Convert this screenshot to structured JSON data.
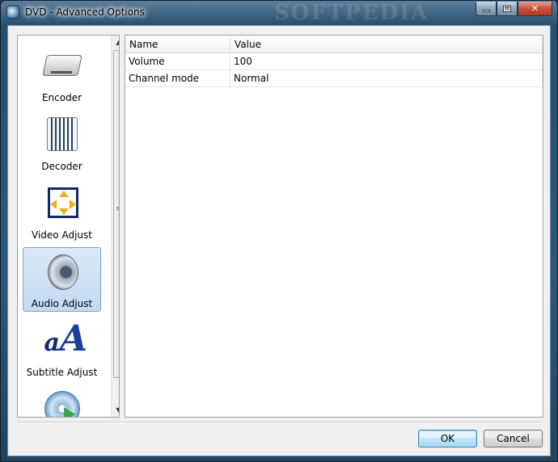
{
  "window": {
    "title": "DVD - Advanced Options",
    "watermark": "SOFTPEDIA"
  },
  "sidebar": {
    "items": [
      {
        "label": "Encoder",
        "icon": "encoder-icon"
      },
      {
        "label": "Decoder",
        "icon": "decoder-icon"
      },
      {
        "label": "Video Adjust",
        "icon": "video-adjust-icon"
      },
      {
        "label": "Audio Adjust",
        "icon": "speaker-icon",
        "selected": true
      },
      {
        "label": "Subtitle Adjust",
        "icon": "subtitle-icon"
      },
      {
        "label": "",
        "icon": "disc-play-icon"
      }
    ]
  },
  "grid": {
    "headers": {
      "name": "Name",
      "value": "Value"
    },
    "rows": [
      {
        "name": "Volume",
        "value": "100"
      },
      {
        "name": "Channel mode",
        "value": "Normal"
      }
    ]
  },
  "buttons": {
    "ok": "OK",
    "cancel": "Cancel"
  },
  "colors": {
    "selection": "#c1d9f2",
    "selection_border": "#7da2ce",
    "default_button": "#3c7fb1"
  }
}
